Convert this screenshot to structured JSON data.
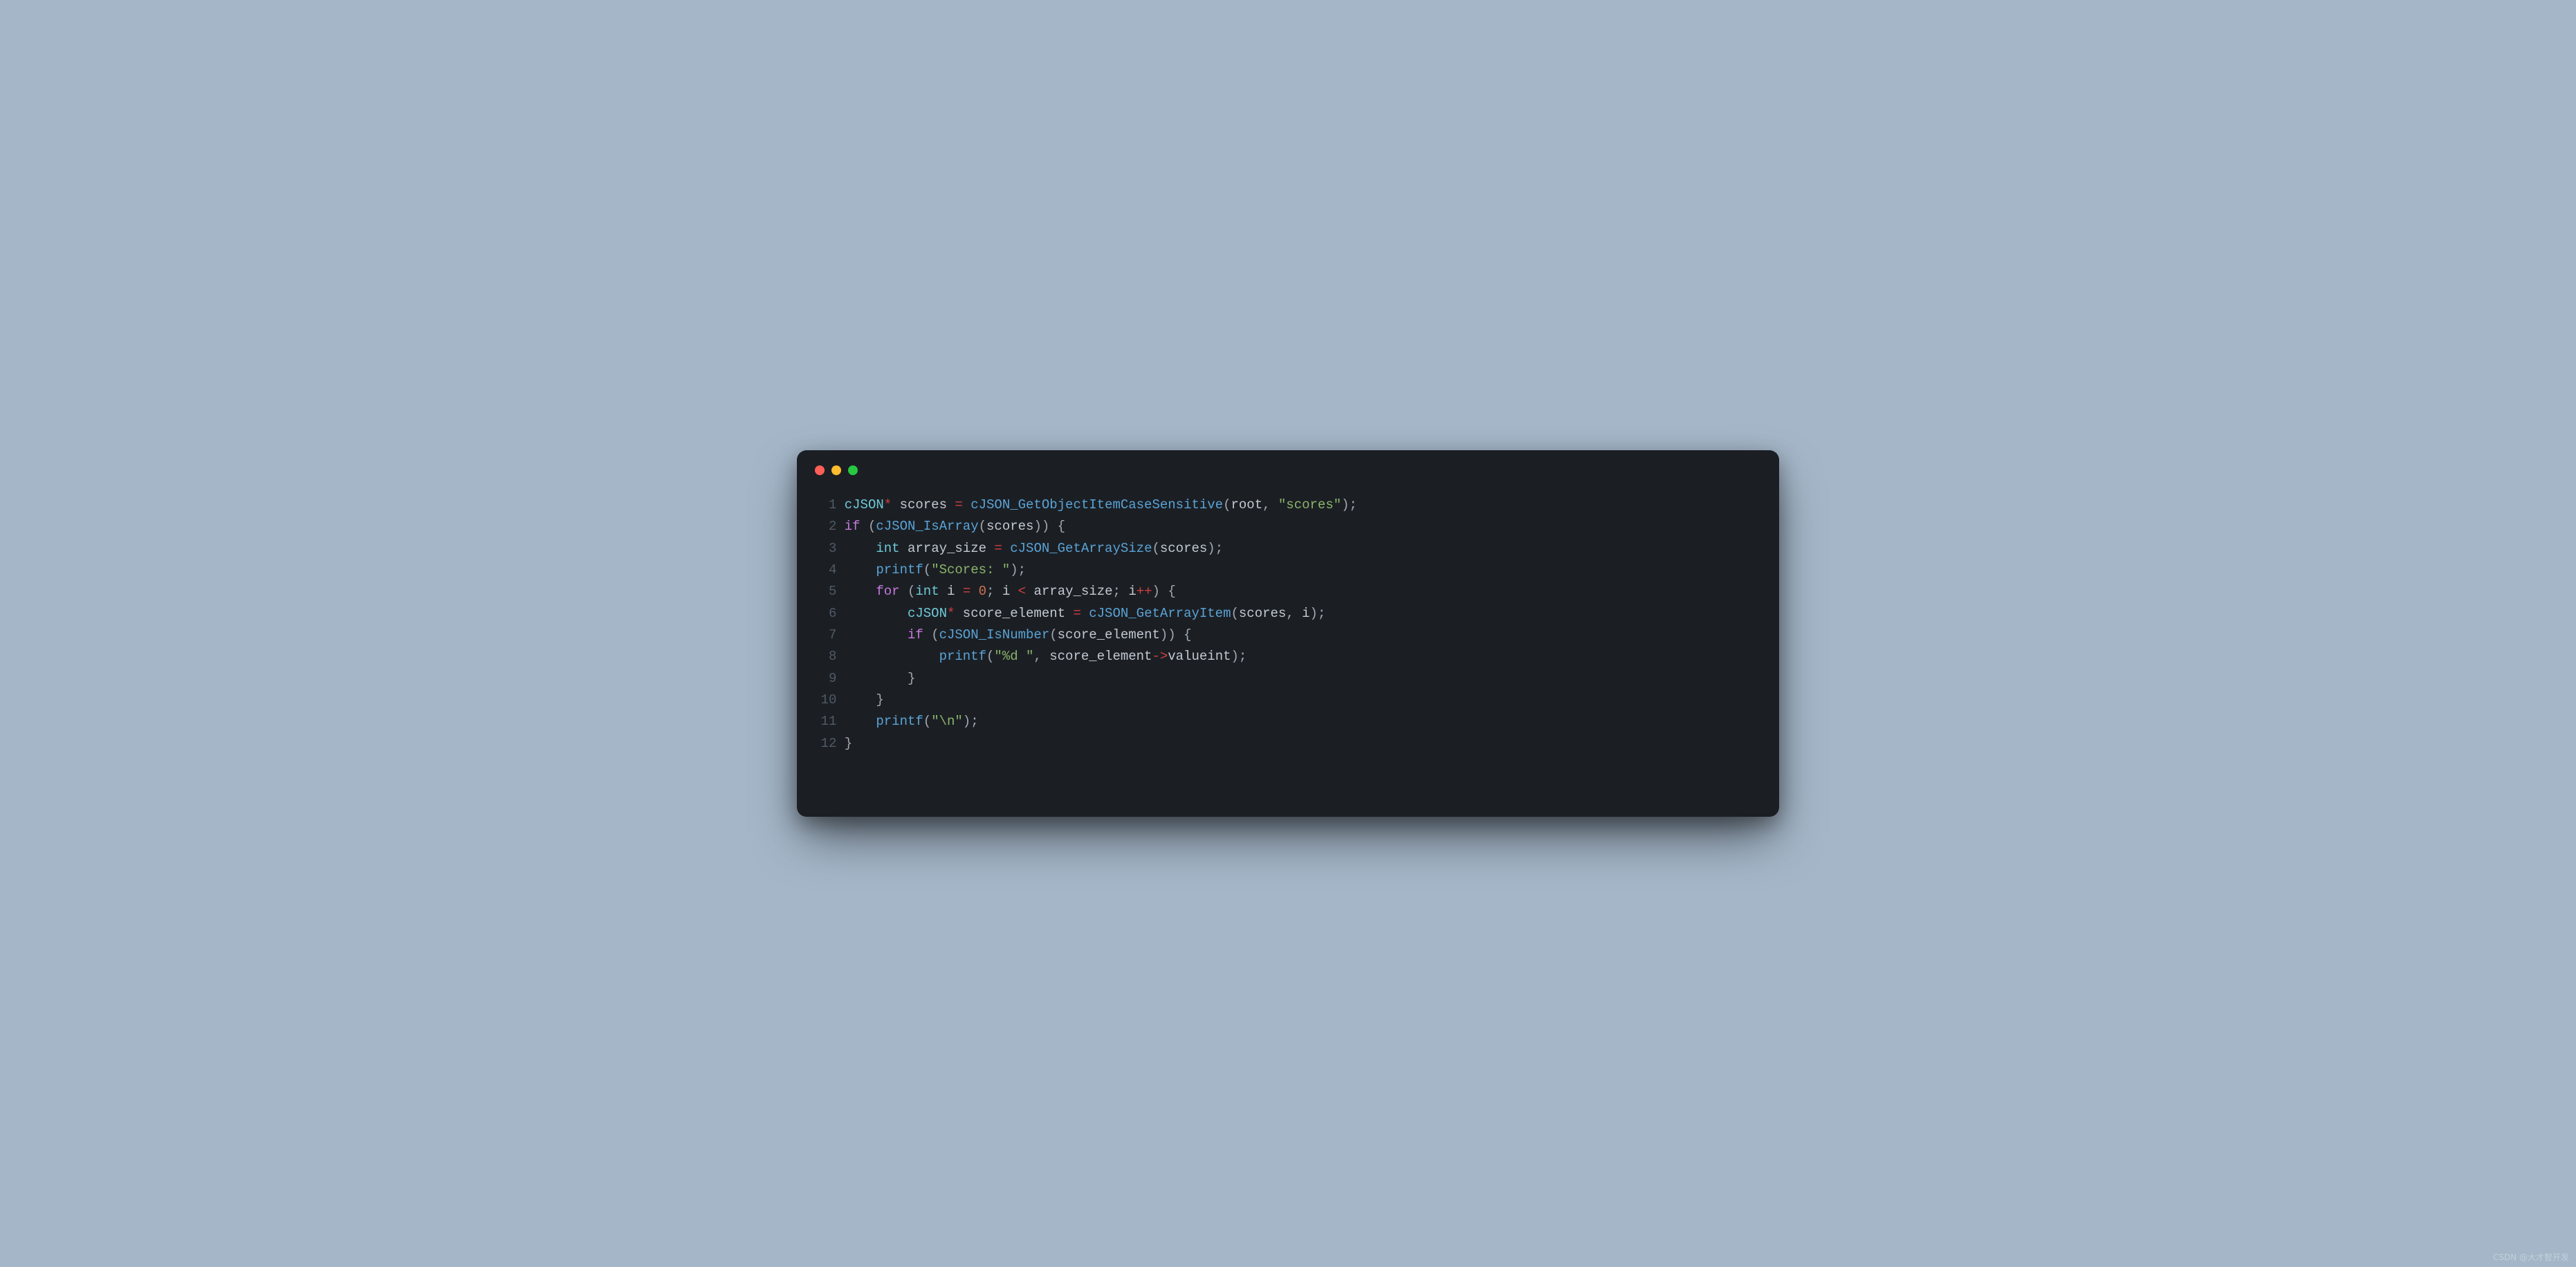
{
  "window": {
    "traffic_lights": [
      "red",
      "yellow",
      "green"
    ]
  },
  "watermark": "CSDN @大才智开发",
  "code": {
    "language": "c",
    "lines": [
      {
        "n": 1,
        "tokens": [
          {
            "t": "cJSON",
            "c": "type"
          },
          {
            "t": "*",
            "c": "op"
          },
          {
            "t": " ",
            "c": "id"
          },
          {
            "t": "scores",
            "c": "id"
          },
          {
            "t": " ",
            "c": "id"
          },
          {
            "t": "=",
            "c": "op"
          },
          {
            "t": " ",
            "c": "id"
          },
          {
            "t": "cJSON_GetObjectItemCaseSensitive",
            "c": "fn"
          },
          {
            "t": "(",
            "c": "pun"
          },
          {
            "t": "root",
            "c": "id"
          },
          {
            "t": ",",
            "c": "pun"
          },
          {
            "t": " ",
            "c": "id"
          },
          {
            "t": "\"scores\"",
            "c": "str"
          },
          {
            "t": ")",
            "c": "pun"
          },
          {
            "t": ";",
            "c": "pun"
          }
        ]
      },
      {
        "n": 2,
        "tokens": [
          {
            "t": "if",
            "c": "kw"
          },
          {
            "t": " ",
            "c": "id"
          },
          {
            "t": "(",
            "c": "pun"
          },
          {
            "t": "cJSON_IsArray",
            "c": "fn"
          },
          {
            "t": "(",
            "c": "pun"
          },
          {
            "t": "scores",
            "c": "id"
          },
          {
            "t": ")",
            "c": "pun"
          },
          {
            "t": ")",
            "c": "pun"
          },
          {
            "t": " ",
            "c": "id"
          },
          {
            "t": "{",
            "c": "pun"
          }
        ]
      },
      {
        "n": 3,
        "tokens": [
          {
            "t": "    ",
            "c": "id"
          },
          {
            "t": "int",
            "c": "type"
          },
          {
            "t": " ",
            "c": "id"
          },
          {
            "t": "array_size",
            "c": "id"
          },
          {
            "t": " ",
            "c": "id"
          },
          {
            "t": "=",
            "c": "op"
          },
          {
            "t": " ",
            "c": "id"
          },
          {
            "t": "cJSON_GetArraySize",
            "c": "fn"
          },
          {
            "t": "(",
            "c": "pun"
          },
          {
            "t": "scores",
            "c": "id"
          },
          {
            "t": ")",
            "c": "pun"
          },
          {
            "t": ";",
            "c": "pun"
          }
        ]
      },
      {
        "n": 4,
        "tokens": [
          {
            "t": "    ",
            "c": "id"
          },
          {
            "t": "printf",
            "c": "fn"
          },
          {
            "t": "(",
            "c": "pun"
          },
          {
            "t": "\"Scores: \"",
            "c": "str"
          },
          {
            "t": ")",
            "c": "pun"
          },
          {
            "t": ";",
            "c": "pun"
          }
        ]
      },
      {
        "n": 5,
        "tokens": [
          {
            "t": "    ",
            "c": "id"
          },
          {
            "t": "for",
            "c": "kw"
          },
          {
            "t": " ",
            "c": "id"
          },
          {
            "t": "(",
            "c": "pun"
          },
          {
            "t": "int",
            "c": "type"
          },
          {
            "t": " ",
            "c": "id"
          },
          {
            "t": "i",
            "c": "id"
          },
          {
            "t": " ",
            "c": "id"
          },
          {
            "t": "=",
            "c": "op"
          },
          {
            "t": " ",
            "c": "id"
          },
          {
            "t": "0",
            "c": "num"
          },
          {
            "t": ";",
            "c": "pun"
          },
          {
            "t": " ",
            "c": "id"
          },
          {
            "t": "i",
            "c": "id"
          },
          {
            "t": " ",
            "c": "id"
          },
          {
            "t": "<",
            "c": "op"
          },
          {
            "t": " ",
            "c": "id"
          },
          {
            "t": "array_size",
            "c": "id"
          },
          {
            "t": ";",
            "c": "pun"
          },
          {
            "t": " ",
            "c": "id"
          },
          {
            "t": "i",
            "c": "id"
          },
          {
            "t": "++",
            "c": "op"
          },
          {
            "t": ")",
            "c": "pun"
          },
          {
            "t": " ",
            "c": "id"
          },
          {
            "t": "{",
            "c": "pun"
          }
        ]
      },
      {
        "n": 6,
        "tokens": [
          {
            "t": "        ",
            "c": "id"
          },
          {
            "t": "cJSON",
            "c": "type"
          },
          {
            "t": "*",
            "c": "op"
          },
          {
            "t": " ",
            "c": "id"
          },
          {
            "t": "score_element",
            "c": "id"
          },
          {
            "t": " ",
            "c": "id"
          },
          {
            "t": "=",
            "c": "op"
          },
          {
            "t": " ",
            "c": "id"
          },
          {
            "t": "cJSON_GetArrayItem",
            "c": "fn"
          },
          {
            "t": "(",
            "c": "pun"
          },
          {
            "t": "scores",
            "c": "id"
          },
          {
            "t": ",",
            "c": "pun"
          },
          {
            "t": " ",
            "c": "id"
          },
          {
            "t": "i",
            "c": "id"
          },
          {
            "t": ")",
            "c": "pun"
          },
          {
            "t": ";",
            "c": "pun"
          }
        ]
      },
      {
        "n": 7,
        "tokens": [
          {
            "t": "        ",
            "c": "id"
          },
          {
            "t": "if",
            "c": "kw"
          },
          {
            "t": " ",
            "c": "id"
          },
          {
            "t": "(",
            "c": "pun"
          },
          {
            "t": "cJSON_IsNumber",
            "c": "fn"
          },
          {
            "t": "(",
            "c": "pun"
          },
          {
            "t": "score_element",
            "c": "id"
          },
          {
            "t": ")",
            "c": "pun"
          },
          {
            "t": ")",
            "c": "pun"
          },
          {
            "t": " ",
            "c": "id"
          },
          {
            "t": "{",
            "c": "pun"
          }
        ]
      },
      {
        "n": 8,
        "tokens": [
          {
            "t": "            ",
            "c": "id"
          },
          {
            "t": "printf",
            "c": "fn"
          },
          {
            "t": "(",
            "c": "pun"
          },
          {
            "t": "\"%d \"",
            "c": "str"
          },
          {
            "t": ",",
            "c": "pun"
          },
          {
            "t": " ",
            "c": "id"
          },
          {
            "t": "score_element",
            "c": "id"
          },
          {
            "t": "->",
            "c": "op"
          },
          {
            "t": "valueint",
            "c": "id"
          },
          {
            "t": ")",
            "c": "pun"
          },
          {
            "t": ";",
            "c": "pun"
          }
        ]
      },
      {
        "n": 9,
        "tokens": [
          {
            "t": "        ",
            "c": "id"
          },
          {
            "t": "}",
            "c": "pun"
          }
        ]
      },
      {
        "n": 10,
        "tokens": [
          {
            "t": "    ",
            "c": "id"
          },
          {
            "t": "}",
            "c": "pun"
          }
        ]
      },
      {
        "n": 11,
        "tokens": [
          {
            "t": "    ",
            "c": "id"
          },
          {
            "t": "printf",
            "c": "fn"
          },
          {
            "t": "(",
            "c": "pun"
          },
          {
            "t": "\"\\n\"",
            "c": "str"
          },
          {
            "t": ")",
            "c": "pun"
          },
          {
            "t": ";",
            "c": "pun"
          }
        ]
      },
      {
        "n": 12,
        "tokens": [
          {
            "t": "}",
            "c": "pun"
          }
        ]
      }
    ]
  }
}
